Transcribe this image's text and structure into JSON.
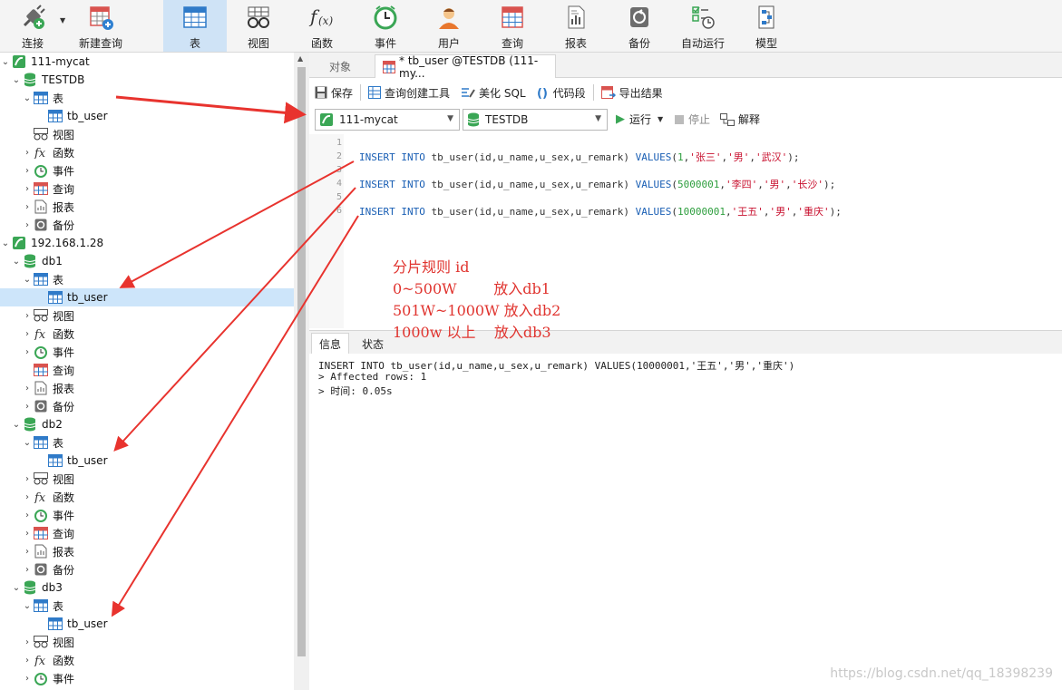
{
  "toolbar": {
    "items": [
      {
        "label": "连接",
        "icon": "plug-icon"
      },
      {
        "label": "新建查询",
        "icon": "new-query-icon"
      },
      {
        "label": "表",
        "icon": "table-icon"
      },
      {
        "label": "视图",
        "icon": "view-icon"
      },
      {
        "label": "函数",
        "icon": "function-icon"
      },
      {
        "label": "事件",
        "icon": "clock-icon"
      },
      {
        "label": "用户",
        "icon": "user-icon"
      },
      {
        "label": "查询",
        "icon": "query-icon"
      },
      {
        "label": "报表",
        "icon": "report-icon"
      },
      {
        "label": "备份",
        "icon": "backup-icon"
      },
      {
        "label": "自动运行",
        "icon": "schedule-icon"
      },
      {
        "label": "模型",
        "icon": "model-icon"
      }
    ],
    "active": "表"
  },
  "nav": {
    "connection1": "111-mycat",
    "db_testdb": "TESTDB",
    "connection2": "192.168.1.28",
    "db1": "db1",
    "db2": "db2",
    "db3": "db3",
    "tables": "表",
    "table_name": "tb_user",
    "views": "视图",
    "functions": "函数",
    "events": "事件",
    "queries": "查询",
    "reports": "报表",
    "backups": "备份"
  },
  "tabs": {
    "objects": "对象",
    "query_tab": "* tb_user @TESTDB (111-my..."
  },
  "query_toolbar": {
    "save": "保存",
    "query_builder": "查询创建工具",
    "beautify": "美化 SQL",
    "snippet": "代码段",
    "export": "导出结果"
  },
  "selectors": {
    "connection": "111-mycat",
    "database": "TESTDB",
    "run": "运行",
    "stop": "停止",
    "explain": "解释"
  },
  "editor": {
    "line_numbers": [
      "1",
      "2",
      "3",
      "4",
      "5",
      "6"
    ],
    "lines": [
      {
        "kw1": "INSERT INTO",
        "mid": " tb_user(id,u_name,u_sex,u_remark) ",
        "kw2": "VALUES",
        "open": "(",
        "num": "1",
        "sep": ",",
        "s1": "'张三'",
        "s2": "'男'",
        "s3": "'武汉'",
        "end": ");"
      },
      {
        "kw1": "INSERT INTO",
        "mid": " tb_user(id,u_name,u_sex,u_remark) ",
        "kw2": "VALUES",
        "open": "(",
        "num": "5000001",
        "sep": ",",
        "s1": "'李四'",
        "s2": "'男'",
        "s3": "'长沙'",
        "end": ");"
      },
      {
        "kw1": "INSERT INTO",
        "mid": " tb_user(id,u_name,u_sex,u_remark) ",
        "kw2": "VALUES",
        "open": "(",
        "num": "10000001",
        "sep": ",",
        "s1": "'王五'",
        "s2": "'男'",
        "s3": "'重庆'",
        "end": ");"
      }
    ]
  },
  "annotation": {
    "lines": [
      "分片规则 id",
      "0~500W        放入db1",
      "501W~1000W 放入db2",
      "1000w 以上    放入db3"
    ]
  },
  "result_tabs": {
    "info": "信息",
    "status": "状态"
  },
  "result": {
    "lines": [
      "INSERT INTO tb_user(id,u_name,u_sex,u_remark) VALUES(10000001,'王五','男','重庆')",
      "> Affected rows: 1",
      "> 时间: 0.05s"
    ]
  },
  "watermark": "https://blog.csdn.net/qq_18398239",
  "colors": {
    "selected_row": "#cde5fa",
    "active_tool": "#cfe3f6",
    "annotation_red": "#e0342f",
    "keyword_blue": "#1a5fb4",
    "string_red": "#c8102e",
    "number_green": "#2e9e3e"
  }
}
